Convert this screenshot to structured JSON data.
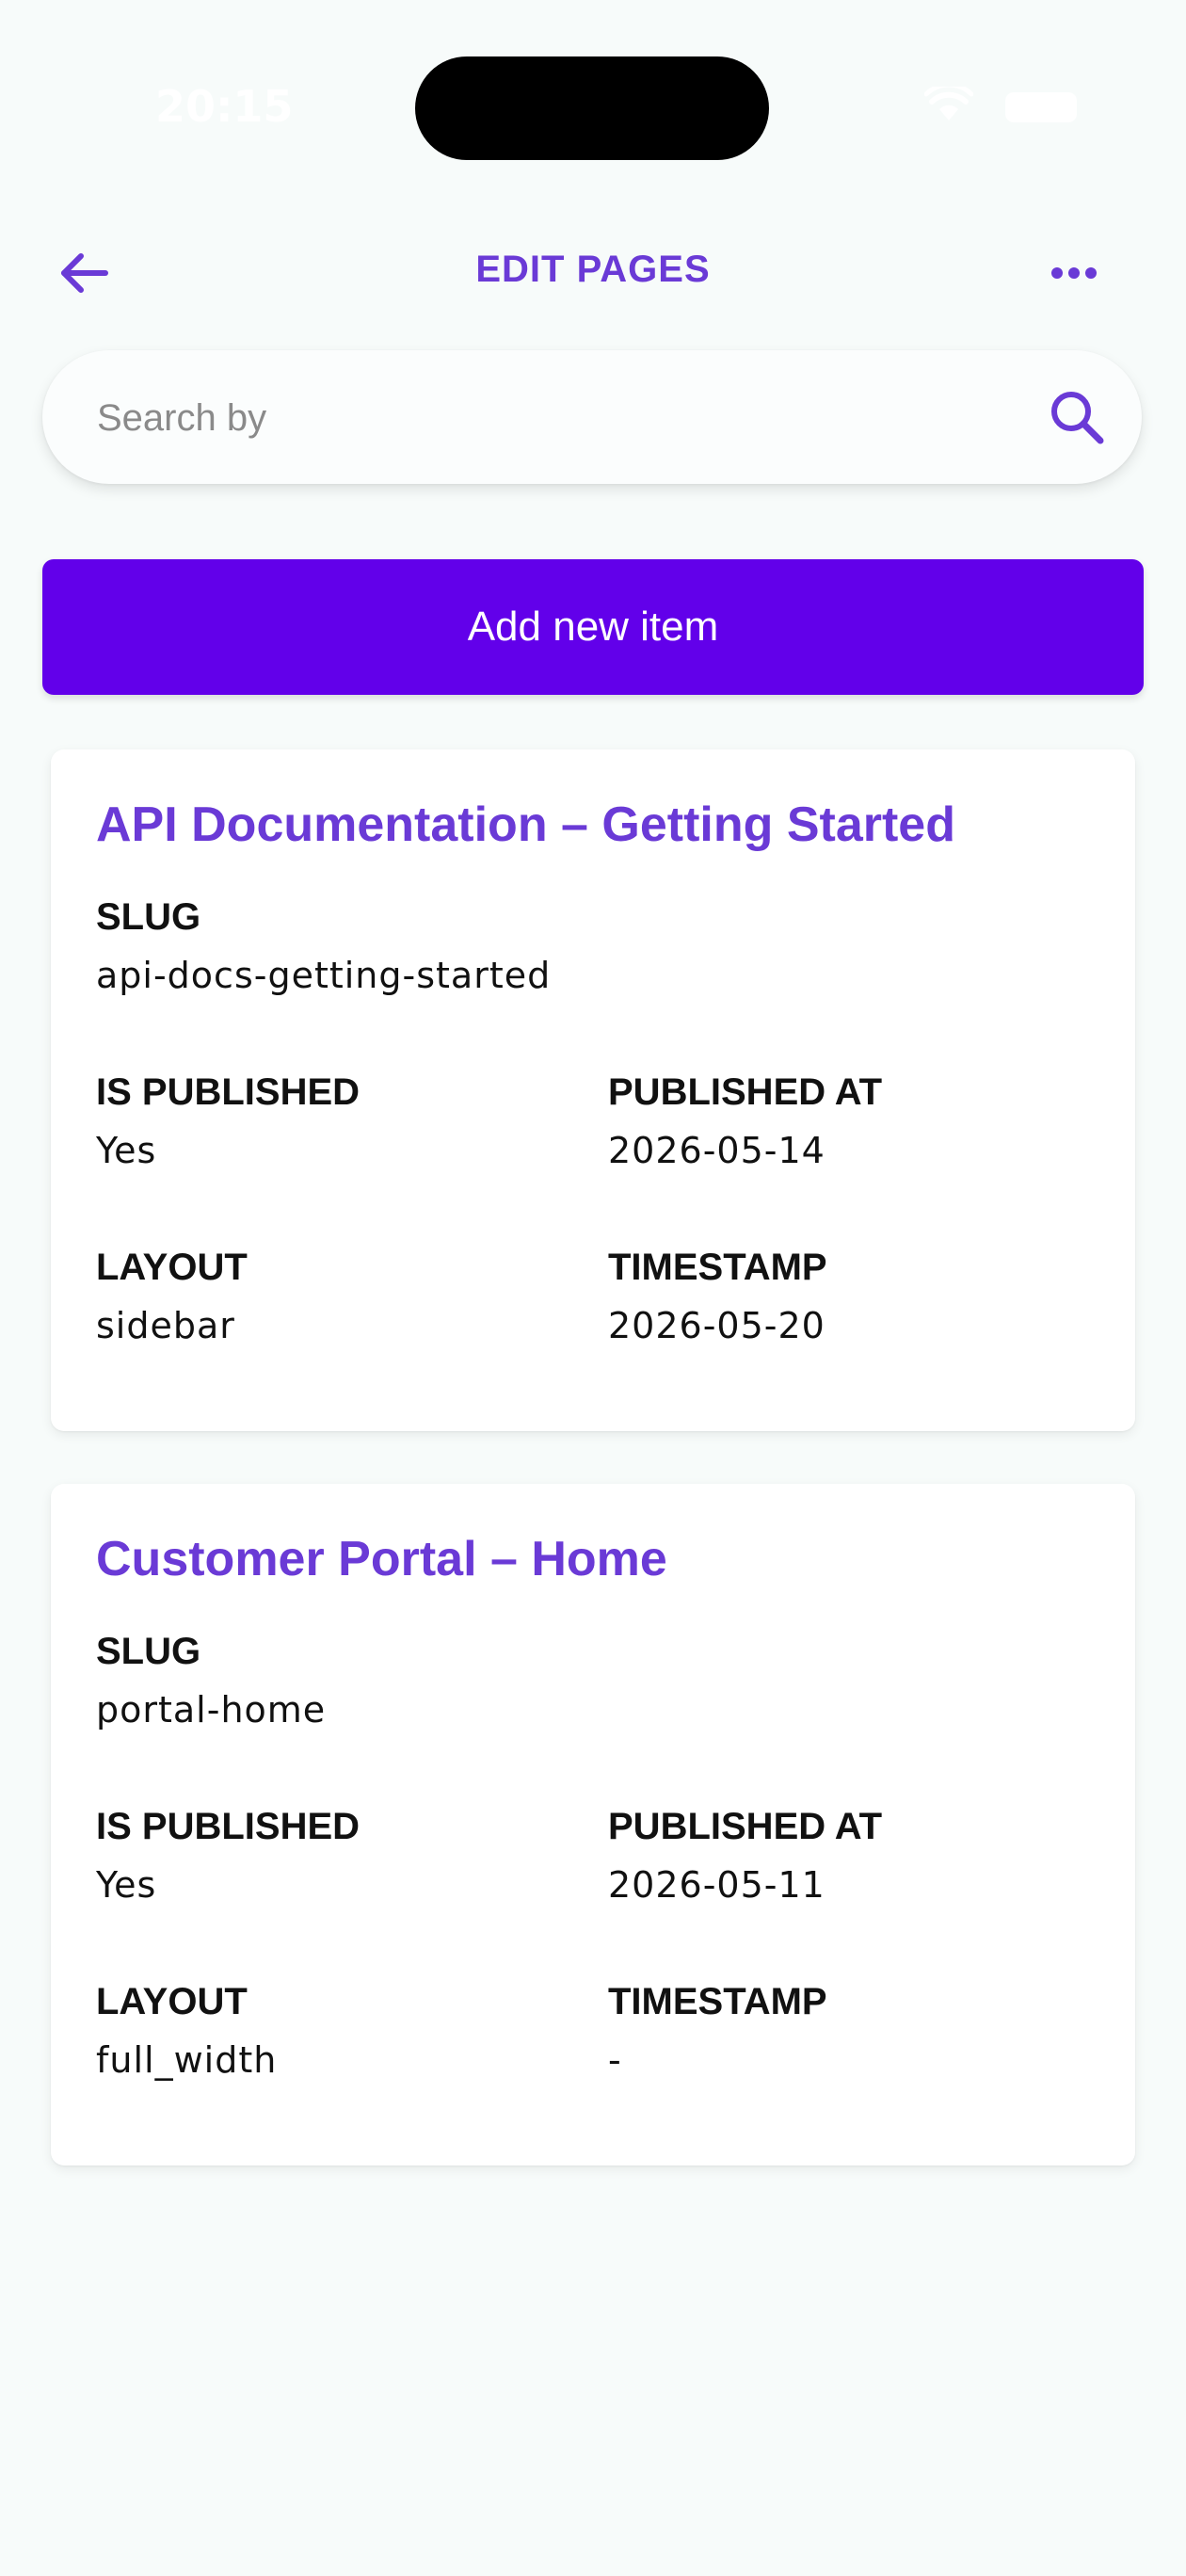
{
  "status_bar": {
    "time": "20:15"
  },
  "header": {
    "title": "EDIT PAGES"
  },
  "search": {
    "placeholder": "Search by"
  },
  "add_button": {
    "label": "Add new item"
  },
  "labels": {
    "slug": "SLUG",
    "is_published": "IS PUBLISHED",
    "published_at": "PUBLISHED AT",
    "layout": "LAYOUT",
    "timestamp": "TIMESTAMP"
  },
  "items": [
    {
      "title": "API Documentation – Getting Started",
      "slug": "api-docs-getting-started",
      "is_published": "Yes",
      "published_at": "2026-05-14",
      "layout": "sidebar",
      "timestamp": "2026-05-20"
    },
    {
      "title": "Customer Portal – Home",
      "slug": "portal-home",
      "is_published": "Yes",
      "published_at": "2026-05-11",
      "layout": "full_width",
      "timestamp": "-"
    }
  ],
  "colors": {
    "accent": "#6a3ad6",
    "button": "#6200ea",
    "background": "#f7fbfa"
  }
}
